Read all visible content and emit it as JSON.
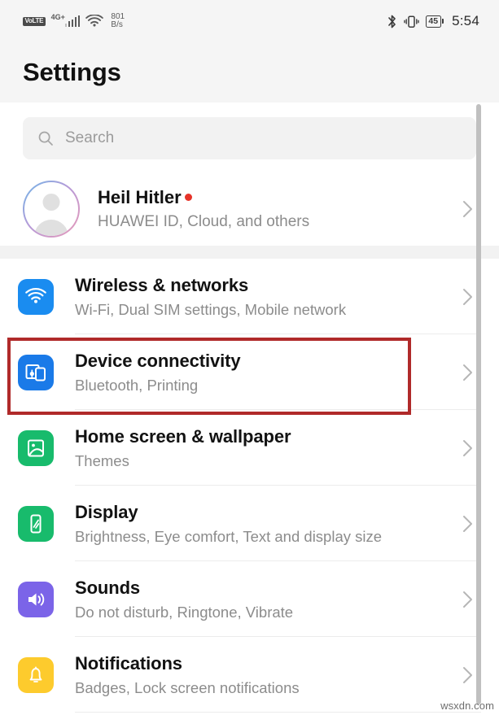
{
  "status_bar": {
    "volte_label": "VoLTE",
    "network_label": "4G+",
    "signal_bars": 5,
    "wifi_icon": "wifi-icon",
    "data_speed_value": "801",
    "data_speed_unit": "B/s",
    "bluetooth_icon": "bluetooth-icon",
    "vibrate_icon": "vibrate-icon",
    "battery_percent": "45",
    "time": "5:54"
  },
  "header": {
    "title": "Settings"
  },
  "search": {
    "placeholder": "Search",
    "value": "",
    "icon": "search-icon"
  },
  "account": {
    "name": "Heil Hitler",
    "subtitle": "HUAWEI ID, Cloud, and others",
    "has_notification_dot": true,
    "avatar_icon": "avatar-placeholder-icon",
    "chevron": "chevron-right-icon"
  },
  "settings_list": [
    {
      "title": "Wireless & networks",
      "subtitle": "Wi-Fi, Dual SIM settings, Mobile network",
      "icon": "wifi-icon",
      "icon_color": "#1a8cf0",
      "highlighted": false
    },
    {
      "title": "Device connectivity",
      "subtitle": "Bluetooth, Printing",
      "icon": "device-connectivity-icon",
      "icon_color": "#1a7ae8",
      "highlighted": true
    },
    {
      "title": "Home screen & wallpaper",
      "subtitle": "Themes",
      "icon": "image-icon",
      "icon_color": "#18bb6c",
      "highlighted": false
    },
    {
      "title": "Display",
      "subtitle": "Brightness, Eye comfort, Text and display size",
      "icon": "display-icon",
      "icon_color": "#18bb6c",
      "highlighted": false
    },
    {
      "title": "Sounds",
      "subtitle": "Do not disturb, Ringtone, Vibrate",
      "icon": "speaker-icon",
      "icon_color": "#7b64e8",
      "highlighted": false
    },
    {
      "title": "Notifications",
      "subtitle": "Badges, Lock screen notifications",
      "icon": "bell-icon",
      "icon_color": "#fdcb2d",
      "highlighted": false
    }
  ],
  "annotation": {
    "highlight_color": "#b02a2a",
    "target": "Device connectivity"
  },
  "watermark": {
    "text": "wsxdn.com"
  }
}
